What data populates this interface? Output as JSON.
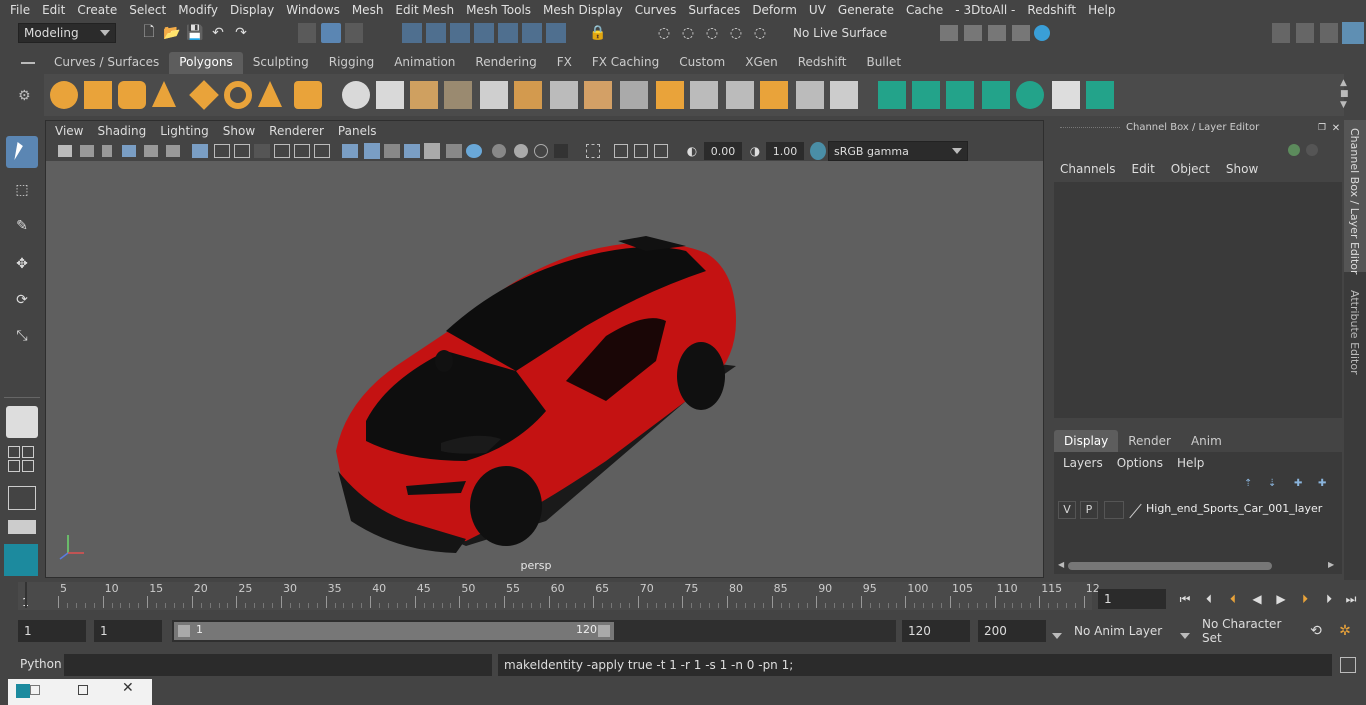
{
  "menubar": {
    "items": [
      "File",
      "Edit",
      "Create",
      "Select",
      "Modify",
      "Display",
      "Windows",
      "Mesh",
      "Edit Mesh",
      "Mesh Tools",
      "Mesh Display",
      "Curves",
      "Surfaces",
      "Deform",
      "UV",
      "Generate",
      "Cache",
      "- 3DtoAll -",
      "Redshift",
      "Help"
    ]
  },
  "status": {
    "mode": "Modeling",
    "live_surface": "No Live Surface"
  },
  "shelf": {
    "tabs": [
      "Curves / Surfaces",
      "Polygons",
      "Sculpting",
      "Rigging",
      "Animation",
      "Rendering",
      "FX",
      "FX Caching",
      "Custom",
      "XGen",
      "Redshift",
      "Bullet"
    ],
    "active_tab": "Polygons"
  },
  "viewport": {
    "menus": [
      "View",
      "Shading",
      "Lighting",
      "Show",
      "Renderer",
      "Panels"
    ],
    "exposure": "0.00",
    "gamma": "1.00",
    "color_space": "sRGB gamma",
    "camera_label": "persp"
  },
  "channelbox": {
    "title": "Channel Box / Layer Editor",
    "menus": [
      "Channels",
      "Edit",
      "Object",
      "Show"
    ],
    "layer_tabs": [
      "Display",
      "Render",
      "Anim"
    ],
    "active_layer_tab": "Display",
    "layer_menus": [
      "Layers",
      "Options",
      "Help"
    ],
    "layer": {
      "v": "V",
      "p": "P",
      "name": "High_end_Sports_Car_001_layer"
    }
  },
  "side_tabs": [
    "Channel Box / Layer Editor",
    "Attribute Editor"
  ],
  "timeline": {
    "ticks": [
      "5",
      "10",
      "15",
      "20",
      "25",
      "30",
      "35",
      "40",
      "45",
      "50",
      "55",
      "60",
      "65",
      "70",
      "75",
      "80",
      "85",
      "90",
      "95",
      "100",
      "105",
      "110",
      "115",
      "12"
    ],
    "start_label": "1",
    "current_frame": "1"
  },
  "range": {
    "start": "1",
    "playback_start": "1",
    "slider_start": "1",
    "slider_end": "120",
    "playback_end": "120",
    "end": "200",
    "anim_layer": "No Anim Layer",
    "character_set": "No Character Set"
  },
  "cmdline": {
    "language": "Python",
    "input": "",
    "result": "makeIdentity -apply true -t 1 -r 1 -s 1 -n 0 -pn 1;"
  },
  "colors": {
    "bg": "#444444",
    "viewport_bg": "#5f5f5f",
    "car_body": "#c41212",
    "shelf_accent": "#e9a33a",
    "teal_accent": "#23a38a"
  }
}
